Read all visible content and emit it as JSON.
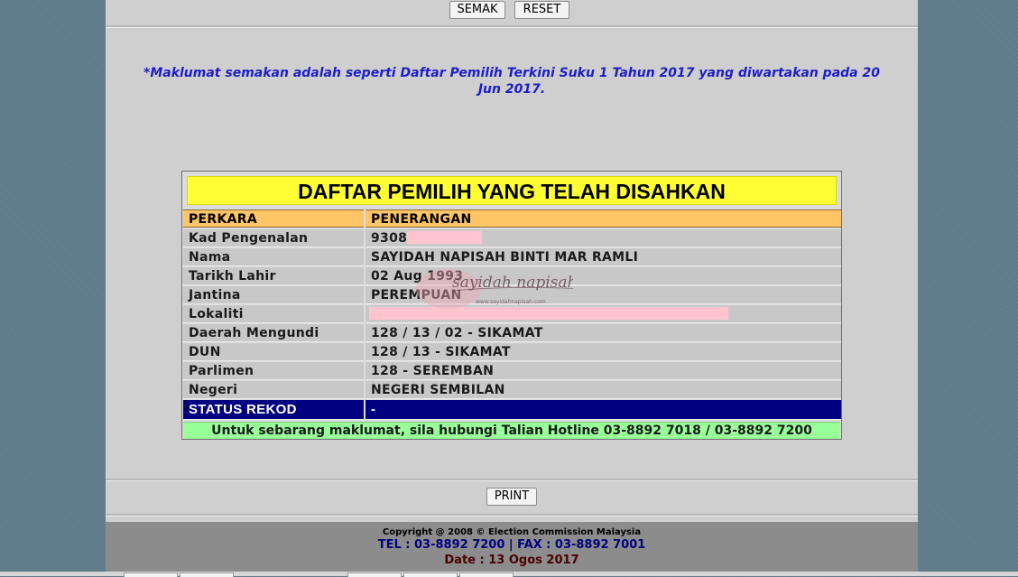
{
  "toolbar": {
    "semak_label": "SEMAK",
    "reset_label": "RESET"
  },
  "notice": "*Maklumat semakan adalah seperti Daftar Pemilih Terkini Suku 1 Tahun 2017 yang diwartakan pada 20 Jun 2017.",
  "table": {
    "title": "DAFTAR PEMILIH YANG TELAH DISAHKAN",
    "header": {
      "col1": "PERKARA",
      "col2": "PENERANGAN"
    },
    "rows": [
      {
        "label": "Kad Pengenalan",
        "value": "9308"
      },
      {
        "label": "Nama",
        "value": "SAYIDAH NAPISAH BINTI MAR RAMLI"
      },
      {
        "label": "Tarikh Lahir",
        "value": "02 Aug 1993"
      },
      {
        "label": "Jantina",
        "value": "PEREMPUAN"
      },
      {
        "label": "Lokaliti",
        "value": ""
      },
      {
        "label": "Daerah Mengundi",
        "value": "128 / 13 / 02 - SIKAMAT"
      },
      {
        "label": "DUN",
        "value": "128 / 13 - SIKAMAT"
      },
      {
        "label": "Parlimen",
        "value": "128 - SEREMBAN"
      },
      {
        "label": "Negeri",
        "value": "NEGERI SEMBILAN"
      }
    ],
    "status": {
      "label": "STATUS REKOD",
      "value": "-"
    },
    "hotline": "Untuk sebarang maklumat, sila hubungi Talian Hotline 03-8892 7018 / 03-8892 7200"
  },
  "watermark": {
    "text": "sayidah napisah",
    "url": "www.sayidahnapisah.com"
  },
  "print_label": "PRINT",
  "footer": {
    "copyright": "Copyright @ 2008 © Election Commission Malaysia",
    "contact": "TEL : 03-8892 7200 | FAX : 03-8892 7001",
    "date": "Date : 13 Ogos 2017"
  },
  "colors": {
    "panel": "#cfcfcf",
    "notice_text": "#1d1dcc",
    "title_bg": "#ffff33",
    "header_bg": "#ffc566",
    "status_bg": "#000080",
    "hotline_bg": "#99ff99",
    "redaction": "#ffc4cf"
  }
}
